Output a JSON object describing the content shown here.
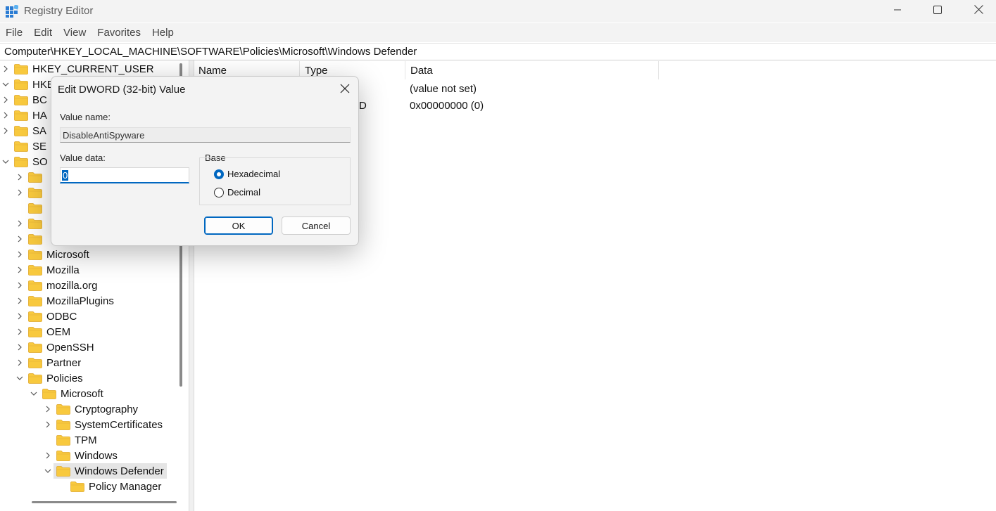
{
  "window": {
    "title": "Registry Editor"
  },
  "menu": [
    "File",
    "Edit",
    "View",
    "Favorites",
    "Help"
  ],
  "address": "Computer\\HKEY_LOCAL_MACHINE\\SOFTWARE\\Policies\\Microsoft\\Windows Defender",
  "tree": {
    "items": [
      {
        "label": "HKEY_CURRENT_USER",
        "chev": ">",
        "level": 0
      },
      {
        "label": "HKEY",
        "chev": "v",
        "level": 0
      },
      {
        "label": "BC",
        "chev": ">",
        "level": 1
      },
      {
        "label": "HA",
        "chev": ">",
        "level": 1
      },
      {
        "label": "SA",
        "chev": ">",
        "level": 1
      },
      {
        "label": "SE",
        "chev": "",
        "level": 1
      },
      {
        "label": "SO",
        "chev": "v",
        "level": 1
      },
      {
        "label": "",
        "chev": ">",
        "level": 2
      },
      {
        "label": "",
        "chev": ">",
        "level": 2
      },
      {
        "label": "",
        "chev": "",
        "level": 2
      },
      {
        "label": "",
        "chev": ">",
        "level": 2
      },
      {
        "label": "",
        "chev": ">",
        "level": 2
      },
      {
        "label": "Microsoft",
        "chev": ">",
        "level": 2
      },
      {
        "label": "Mozilla",
        "chev": ">",
        "level": 2
      },
      {
        "label": "mozilla.org",
        "chev": ">",
        "level": 2
      },
      {
        "label": "MozillaPlugins",
        "chev": ">",
        "level": 2
      },
      {
        "label": "ODBC",
        "chev": ">",
        "level": 2
      },
      {
        "label": "OEM",
        "chev": ">",
        "level": 2
      },
      {
        "label": "OpenSSH",
        "chev": ">",
        "level": 2
      },
      {
        "label": "Partner",
        "chev": ">",
        "level": 2
      },
      {
        "label": "Policies",
        "chev": "v",
        "level": 2
      },
      {
        "label": "Microsoft",
        "chev": "v",
        "level": 3
      },
      {
        "label": "Cryptography",
        "chev": ">",
        "level": 4
      },
      {
        "label": "SystemCertificates",
        "chev": ">",
        "level": 4
      },
      {
        "label": "TPM",
        "chev": "",
        "level": 4
      },
      {
        "label": "Windows",
        "chev": ">",
        "level": 4
      },
      {
        "label": "Windows Defender",
        "chev": "v",
        "level": 4,
        "selected": true
      },
      {
        "label": "Policy Manager",
        "chev": "",
        "level": 5
      }
    ]
  },
  "list": {
    "columns": [
      "Name",
      "Type",
      "Data"
    ],
    "rows": [
      {
        "type": "",
        "data": "(value not set)"
      },
      {
        "type": "D",
        "data": "0x00000000 (0)"
      }
    ]
  },
  "dialog": {
    "title": "Edit DWORD (32-bit) Value",
    "value_name_label": "Value name:",
    "value_name": "DisableAntiSpyware",
    "value_data_label": "Value data:",
    "value_data": "0",
    "base_label": "Base",
    "hex_label": "Hexadecimal",
    "dec_label": "Decimal",
    "base_selected": "Hexadecimal",
    "ok_label": "OK",
    "cancel_label": "Cancel"
  },
  "colors": {
    "accent": "#0067c0",
    "folder": "#f8c93e",
    "selected": "#e5e5e5"
  },
  "icons": [
    "registry-editor-icon",
    "minimize-icon",
    "maximize-icon",
    "close-icon",
    "folder-icon",
    "chevron-right-icon",
    "chevron-down-icon"
  ]
}
